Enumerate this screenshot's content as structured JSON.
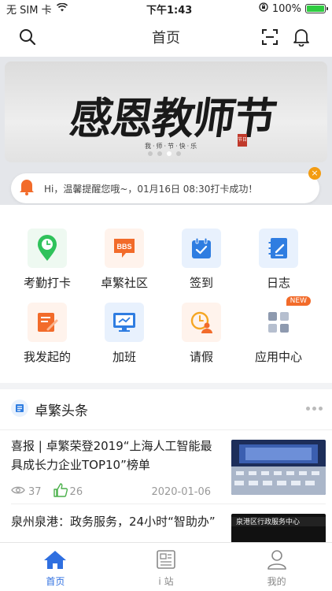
{
  "status": {
    "carrier": "无 SIM 卡",
    "time": "下午1:43",
    "battery": "100%",
    "battery_level": 1.0
  },
  "nav": {
    "title": "首页"
  },
  "banner": {
    "title": "感恩教师节",
    "subtitle": "我·师·节·快·乐",
    "seal": "节日",
    "slides": 4,
    "active_slide": 2
  },
  "notice": {
    "text": "Hi，温馨提醒您哦~，01月16日 08:30打卡成功！"
  },
  "grid": [
    {
      "label": "考勤打卡",
      "icon": "location-clock-icon",
      "color": "#2fc25b"
    },
    {
      "label": "卓繁社区",
      "icon": "bbs-icon",
      "color": "#f26b2a"
    },
    {
      "label": "签到",
      "icon": "calendar-check-icon",
      "color": "#2f7de1"
    },
    {
      "label": "日志",
      "icon": "notebook-icon",
      "color": "#2f7de1"
    },
    {
      "label": "我发起的",
      "icon": "document-edit-icon",
      "color": "#f26b2a"
    },
    {
      "label": "加班",
      "icon": "monitor-icon",
      "color": "#2f7de1"
    },
    {
      "label": "请假",
      "icon": "clock-person-icon",
      "color": "#f5a623"
    },
    {
      "label": "应用中心",
      "icon": "apps-grid-icon",
      "color": "#8e9aaf",
      "badge": "NEW"
    }
  ],
  "news": {
    "title": "卓繁头条",
    "articles": [
      {
        "title": "喜报 | 卓繁荣登2019“上海人工智能最具成长力企业TOP10”榜单",
        "views": "37",
        "likes": "26",
        "date": "2020-01-06"
      },
      {
        "title": "泉州泉港：政务服务，24小时“智助办”",
        "thumb_text": "泉港区行政服务中心"
      }
    ]
  },
  "tabs": [
    {
      "label": "首页",
      "icon": "home-icon",
      "active": true
    },
    {
      "label": "i 站",
      "icon": "news-icon",
      "active": false
    },
    {
      "label": "我的",
      "icon": "user-icon",
      "active": false
    }
  ]
}
